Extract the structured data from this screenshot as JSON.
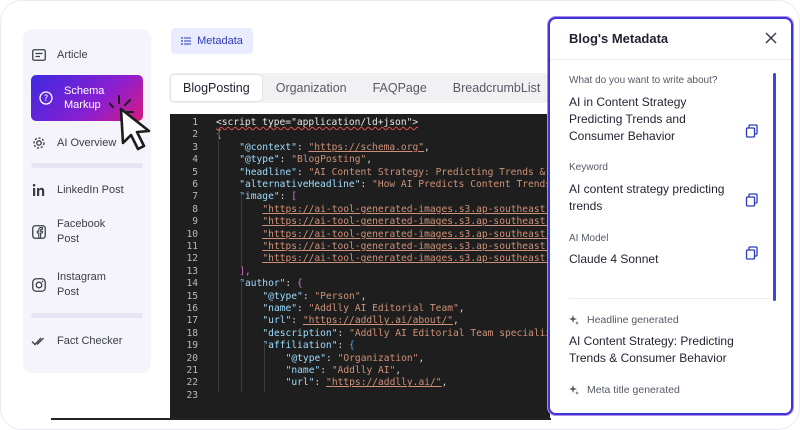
{
  "sidebar": {
    "items": [
      {
        "label": "Article",
        "icon": "article-icon"
      },
      {
        "label": "Schema Markup",
        "icon": "question-circle-icon",
        "active": true
      },
      {
        "label": "AI Overview",
        "icon": "gear-icon"
      },
      {
        "label": "LinkedIn Post",
        "icon": "linkedin-icon"
      },
      {
        "label": "Facebook Post",
        "icon": "facebook-icon"
      },
      {
        "label": "Instagram Post",
        "icon": "instagram-icon"
      },
      {
        "label": "Fact Checker",
        "icon": "check-double-icon"
      }
    ]
  },
  "toolbar": {
    "metadata_label": "Metadata"
  },
  "tabs": [
    {
      "label": "BlogPosting",
      "active": true
    },
    {
      "label": "Organization"
    },
    {
      "label": "FAQPage"
    },
    {
      "label": "BreadcrumbList"
    }
  ],
  "editor": {
    "line_numbers": [
      "1",
      "2",
      "3",
      "4",
      "5",
      "6",
      "7",
      "8",
      "9",
      "10",
      "11",
      "12",
      "13",
      "14",
      "15",
      "16",
      "17",
      "18",
      "19",
      "20",
      "21",
      "22",
      "23"
    ],
    "lines": [
      [
        {
          "t": "<script type=\"application/ld+json\">",
          "c": "#e6e6e6"
        }
      ],
      [
        {
          "t": "{",
          "c": "#f5d343"
        }
      ],
      [
        {
          "t": "\"@context\"",
          "c": "#9cdcfe"
        },
        {
          "t": ": ",
          "c": "#d4d4d4"
        },
        {
          "t": "\"https://schema.org\"",
          "c": "#ce9178",
          "u": true
        },
        {
          "t": ",",
          "c": "#d4d4d4"
        }
      ],
      [
        {
          "t": "\"@type\"",
          "c": "#9cdcfe"
        },
        {
          "t": ": ",
          "c": "#d4d4d4"
        },
        {
          "t": "\"BlogPosting\"",
          "c": "#ce9178"
        },
        {
          "t": ",",
          "c": "#d4d4d4"
        }
      ],
      [
        {
          "t": "\"headline\"",
          "c": "#9cdcfe"
        },
        {
          "t": ": ",
          "c": "#d4d4d4"
        },
        {
          "t": "\"AI Content Strategy: Predicting Trends & C",
          "c": "#ce9178"
        }
      ],
      [
        {
          "t": "\"alternativeHeadline\"",
          "c": "#9cdcfe"
        },
        {
          "t": ": ",
          "c": "#d4d4d4"
        },
        {
          "t": "\"How AI Predicts Content Trends",
          "c": "#ce9178"
        }
      ],
      [
        {
          "t": "\"image\"",
          "c": "#9cdcfe"
        },
        {
          "t": ": ",
          "c": "#d4d4d4"
        },
        {
          "t": "[",
          "c": "#da70d6"
        }
      ],
      [
        {
          "t": "\"https://ai-tool-generated-images.s3.ap-southeast-",
          "c": "#ce9178",
          "u": true
        }
      ],
      [
        {
          "t": "\"https://ai-tool-generated-images.s3.ap-southeast-",
          "c": "#ce9178",
          "u": true
        }
      ],
      [
        {
          "t": "\"https://ai-tool-generated-images.s3.ap-southeast-",
          "c": "#ce9178",
          "u": true
        }
      ],
      [
        {
          "t": "\"https://ai-tool-generated-images.s3.ap-southeast-",
          "c": "#ce9178",
          "u": true
        }
      ],
      [
        {
          "t": "\"https://ai-tool-generated-images.s3.ap-southeast-",
          "c": "#ce9178",
          "u": true
        }
      ],
      [
        {
          "t": "],",
          "c": "#da70d6"
        }
      ],
      [
        {
          "t": "\"author\"",
          "c": "#9cdcfe"
        },
        {
          "t": ": ",
          "c": "#d4d4d4"
        },
        {
          "t": "{",
          "c": "#da70d6"
        }
      ],
      [
        {
          "t": "\"@type\"",
          "c": "#9cdcfe"
        },
        {
          "t": ": ",
          "c": "#d4d4d4"
        },
        {
          "t": "\"Person\"",
          "c": "#ce9178"
        },
        {
          "t": ",",
          "c": "#d4d4d4"
        }
      ],
      [
        {
          "t": "\"name\"",
          "c": "#9cdcfe"
        },
        {
          "t": ": ",
          "c": "#d4d4d4"
        },
        {
          "t": "\"Addlly AI Editorial Team\"",
          "c": "#ce9178"
        },
        {
          "t": ",",
          "c": "#d4d4d4"
        }
      ],
      [
        {
          "t": "\"url\"",
          "c": "#9cdcfe"
        },
        {
          "t": ": ",
          "c": "#d4d4d4"
        },
        {
          "t": "\"https://addlly.ai/about/\"",
          "c": "#ce9178",
          "u": true
        },
        {
          "t": ",",
          "c": "#d4d4d4"
        }
      ],
      [
        {
          "t": "\"description\"",
          "c": "#9cdcfe"
        },
        {
          "t": ": ",
          "c": "#d4d4d4"
        },
        {
          "t": "\"Addlly AI Editorial Team specializ",
          "c": "#ce9178"
        }
      ],
      [
        {
          "t": "\"affiliation\"",
          "c": "#9cdcfe"
        },
        {
          "t": ": ",
          "c": "#d4d4d4"
        },
        {
          "t": "{",
          "c": "#5aa0f0"
        }
      ],
      [
        {
          "t": "\"@type\"",
          "c": "#9cdcfe"
        },
        {
          "t": ": ",
          "c": "#d4d4d4"
        },
        {
          "t": "\"Organization\"",
          "c": "#ce9178"
        },
        {
          "t": ",",
          "c": "#d4d4d4"
        }
      ],
      [
        {
          "t": "\"name\"",
          "c": "#9cdcfe"
        },
        {
          "t": ": ",
          "c": "#d4d4d4"
        },
        {
          "t": "\"Addlly AI\"",
          "c": "#ce9178"
        },
        {
          "t": ",",
          "c": "#d4d4d4"
        }
      ],
      [
        {
          "t": "\"url\"",
          "c": "#9cdcfe"
        },
        {
          "t": ": ",
          "c": "#d4d4d4"
        },
        {
          "t": "\"https://addlly.ai/\"",
          "c": "#ce9178",
          "u": true
        },
        {
          "t": ",",
          "c": "#d4d4d4"
        }
      ],
      [
        {
          "t": "",
          "c": "#d4d4d4"
        }
      ]
    ]
  },
  "panel": {
    "title": "Blog's Metadata",
    "fields": [
      {
        "label": "What do you want to write about?",
        "value": "AI in Content Strategy Predicting Trends and Consumer Behavior"
      },
      {
        "label": "Keyword",
        "value": "AI content strategy predicting trends"
      },
      {
        "label": "AI Model",
        "value": "Claude 4 Sonnet"
      }
    ],
    "generated": [
      {
        "label": "Headline generated",
        "value": "AI Content Strategy: Predicting Trends & Consumer Behavior"
      },
      {
        "label": "Meta title generated",
        "value": ""
      }
    ]
  },
  "colors": {
    "accent": "#3a36d8",
    "active_gradient_start": "#3d2ae0",
    "active_gradient_end": "#d61a7f",
    "editor_bg": "#1e1e1e"
  }
}
